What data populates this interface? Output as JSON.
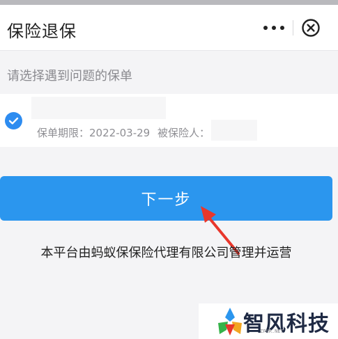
{
  "header": {
    "title": "保险退保",
    "more_icon": "more-dots-icon",
    "close_icon": "close-circle-icon"
  },
  "policy_section": {
    "label": "请选择遇到问题的保单",
    "policy": {
      "checked": true,
      "term_label": "保单期限：",
      "term_value": "2022-03-29",
      "insured_label": "被保险人："
    }
  },
  "next_button": {
    "label": "下一步"
  },
  "footer": {
    "text": "本平台由蚂蚁保保险代理有限公司管理并运营"
  },
  "watermark": {
    "brand": "智风科技",
    "url": "ZFKR.NET"
  },
  "colors": {
    "accent": "#2b96ee",
    "check": "#2d8cf0",
    "annotation_arrow": "#e8372c"
  }
}
